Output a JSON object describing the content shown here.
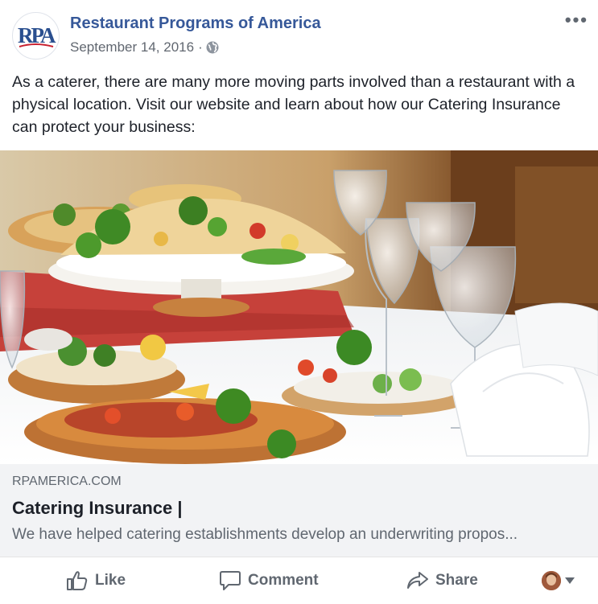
{
  "post": {
    "page_name": "Restaurant Programs of America",
    "avatar_text": "RPA",
    "date": "September 14, 2016",
    "separator": "·",
    "privacy_icon": "globe-icon",
    "more_label": "•••",
    "text": "As a caterer, there are many more moving parts involved than a restaurant with a physical location. Visit our website and learn about how our Catering Insurance can protect your business:"
  },
  "link_preview": {
    "domain": "RPAMERICA.COM",
    "title": "Catering Insurance |",
    "description": "We have helped catering establishments develop an underwriting propos..."
  },
  "actions": {
    "like": "Like",
    "comment": "Comment",
    "share": "Share",
    "reactor_icon": "user-avatar-icon"
  },
  "colors": {
    "page_name": "#365899",
    "link_bg": "#f2f3f5",
    "muted": "#606770",
    "logo_blue": "#2a4f8f",
    "logo_red": "#c8202f"
  }
}
